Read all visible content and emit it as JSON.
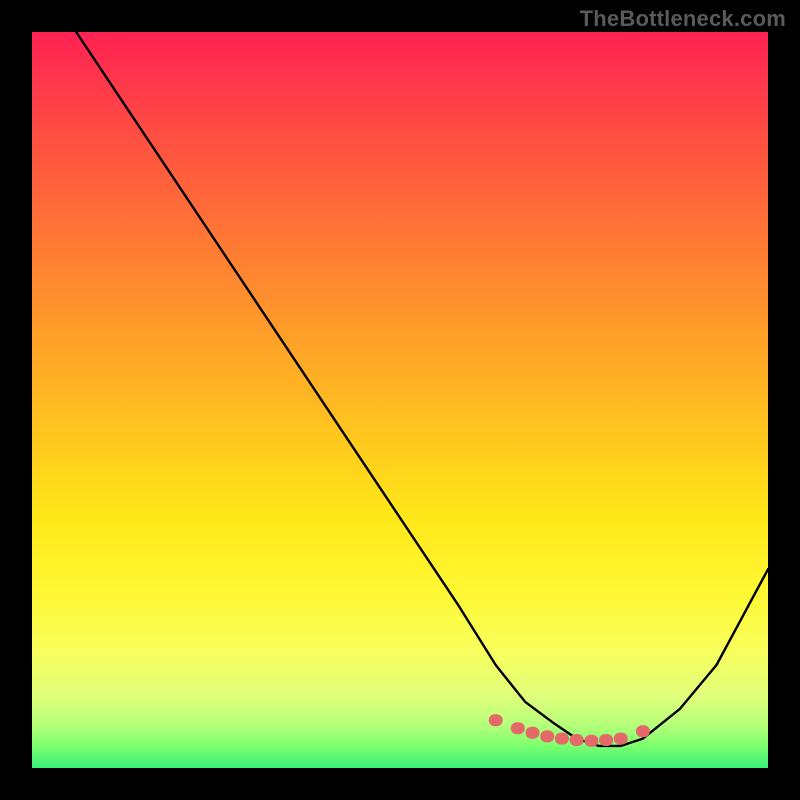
{
  "watermark": "TheBottleneck.com",
  "chart_data": {
    "type": "line",
    "title": "",
    "xlabel": "",
    "ylabel": "",
    "xlim": [
      0,
      100
    ],
    "ylim": [
      0,
      100
    ],
    "series": [
      {
        "name": "curve",
        "x": [
          6,
          10,
          20,
          30,
          40,
          50,
          58,
          63,
          67,
          71,
          74,
          77,
          80,
          83,
          88,
          93,
          100
        ],
        "y": [
          100,
          94,
          79,
          64,
          49,
          34,
          22,
          14,
          9,
          6,
          4,
          3,
          3,
          4,
          8,
          14,
          27
        ]
      }
    ],
    "markers": {
      "name": "highlight-dots",
      "color": "#e46a6a",
      "x": [
        63,
        66,
        68,
        70,
        72,
        74,
        76,
        78,
        80,
        83
      ],
      "y": [
        6.5,
        5.4,
        4.8,
        4.3,
        4.0,
        3.8,
        3.7,
        3.8,
        4.0,
        5.0
      ]
    },
    "gradient_stops": [
      {
        "pos": 0,
        "color": "#ff2253"
      },
      {
        "pos": 8,
        "color": "#ff3b4a"
      },
      {
        "pos": 18,
        "color": "#ff5a3e"
      },
      {
        "pos": 30,
        "color": "#ff7d33"
      },
      {
        "pos": 42,
        "color": "#ffa128"
      },
      {
        "pos": 55,
        "color": "#ffc71e"
      },
      {
        "pos": 66,
        "color": "#ffe819"
      },
      {
        "pos": 76,
        "color": "#fff833"
      },
      {
        "pos": 84,
        "color": "#f8ff5c"
      },
      {
        "pos": 90,
        "color": "#e2ff7a"
      },
      {
        "pos": 94,
        "color": "#b8ff7a"
      },
      {
        "pos": 97,
        "color": "#7dff6e"
      },
      {
        "pos": 100,
        "color": "#36f07a"
      }
    ]
  }
}
